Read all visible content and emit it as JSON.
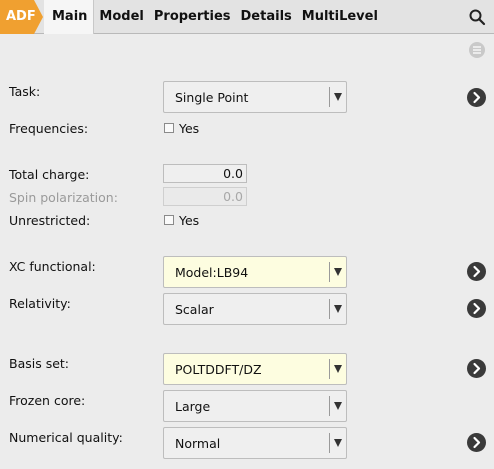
{
  "tabs": {
    "adf": "ADF",
    "items": [
      "Main",
      "Model",
      "Properties",
      "Details",
      "MultiLevel"
    ]
  },
  "icons": {
    "search": "search-icon",
    "menu": "menu-icon",
    "details": "chevron-right-icon"
  },
  "colors": {
    "adf_tab": "#f0a030",
    "highlight_field": "#fdfde0"
  },
  "form": {
    "task": {
      "label": "Task:",
      "value": "Single Point"
    },
    "frequencies": {
      "label": "Frequencies:",
      "checkbox_label": "Yes",
      "checked": false
    },
    "total_charge": {
      "label": "Total charge:",
      "value": "0.0"
    },
    "spin_polarization": {
      "label": "Spin polarization:",
      "value": "0.0"
    },
    "unrestricted": {
      "label": "Unrestricted:",
      "checkbox_label": "Yes",
      "checked": false
    },
    "xc_functional": {
      "label": "XC functional:",
      "value": "Model:LB94"
    },
    "relativity": {
      "label": "Relativity:",
      "value": "Scalar"
    },
    "basis_set": {
      "label": "Basis set:",
      "value": "POLTDDFT/DZ"
    },
    "frozen_core": {
      "label": "Frozen core:",
      "value": "Large"
    },
    "numerical_quality": {
      "label": "Numerical quality:",
      "value": "Normal"
    }
  }
}
